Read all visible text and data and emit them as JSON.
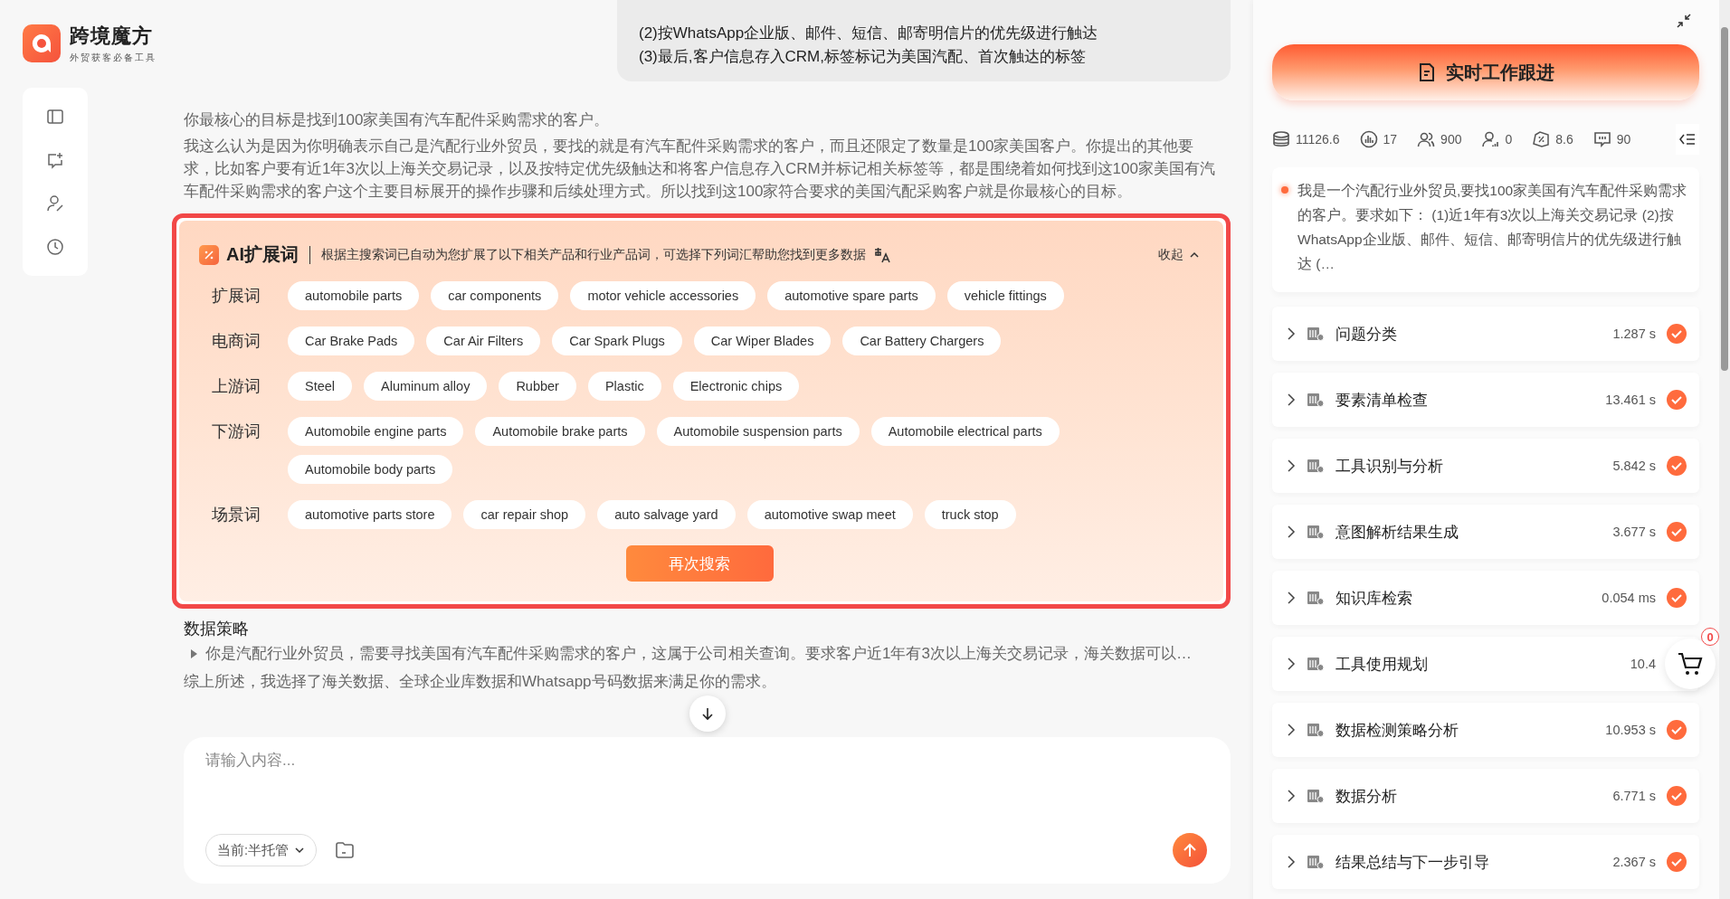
{
  "brand": {
    "name": "跨境魔方",
    "tagline": "外贸获客必备工具"
  },
  "chat": {
    "user_bubble": [
      "(2)按WhatsApp企业版、邮件、短信、邮寄明信片的优先级进行触达",
      "(3)最后,客户信息存入CRM,标签标记为美国汽配、首次触达的标签"
    ],
    "paragraphs": [
      "你最核心的目标是找到100家美国有汽车配件采购需求的客户。",
      "我这么认为是因为你明确表示自己是汽配行业外贸员，要找的就是有汽车配件采购需求的客户，而且还限定了数量是100家美国客户。你提出的其他要求，比如客户要有近1年3次以上海关交易记录，以及按特定优先级触达和将客户信息存入CRM并标记相关标签等，都是围绕着如何找到这100家美国有汽车配件采购需求的客户这个主要目标展开的操作步骤和后续处理方式。所以找到这100家符合要求的美国汽配采购客户就是你最核心的目标。"
    ]
  },
  "ai_panel": {
    "title": "AI扩展词",
    "description": "根据主搜索词已自动为您扩展了以下相关产品和行业产品词，可选择下列词汇帮助您找到更多数据",
    "collapse": "收起",
    "expanded": true,
    "groups": [
      {
        "label": "扩展词",
        "terms": [
          "automobile parts",
          "car components",
          "motor vehicle accessories",
          "automotive spare parts",
          "vehicle fittings"
        ]
      },
      {
        "label": "电商词",
        "terms": [
          "Car Brake Pads",
          "Car Air Filters",
          "Car Spark Plugs",
          "Car Wiper Blades",
          "Car Battery Chargers"
        ]
      },
      {
        "label": "上游词",
        "terms": [
          "Steel",
          "Aluminum alloy",
          "Rubber",
          "Plastic",
          "Electronic chips"
        ]
      },
      {
        "label": "下游词",
        "terms": [
          "Automobile engine parts",
          "Automobile brake parts",
          "Automobile suspension parts",
          "Automobile electrical parts",
          "Automobile body parts"
        ]
      },
      {
        "label": "场景词",
        "terms": [
          "automotive parts store",
          "car repair shop",
          "auto salvage yard",
          "automotive swap meet",
          "truck stop"
        ]
      }
    ],
    "search_button": "再次搜索"
  },
  "strategy": {
    "title": "数据策略",
    "summary": "你是汽配行业外贸员，需要寻找美国有汽车配件采购需求的客户，这属于公司相关查询。要求客户近1年有3次以上海关交易记录，海关数据可以…",
    "expanded": false,
    "conclusion": "综上所述，我选择了海关数据、全球企业库数据和Whatsapp号码数据来满足你的需求。"
  },
  "composer": {
    "placeholder": "请输入内容...",
    "mode": "当前:半托管"
  },
  "tracker": {
    "title": "实时工作跟进",
    "stats": [
      {
        "kind": "coins",
        "value": "11126.6"
      },
      {
        "kind": "chart",
        "value": "17"
      },
      {
        "kind": "users",
        "value": "900"
      },
      {
        "kind": "user-signal",
        "value": "0"
      },
      {
        "kind": "discount",
        "value": "8.6"
      },
      {
        "kind": "chat",
        "value": "90"
      }
    ],
    "task": "我是一个汽配行业外贸员,要找100家美国有汽车配件采购需求的客户。要求如下： (1)近1年有3次以上海关交易记录 (2)按WhatsApp企业版、邮件、短信、邮寄明信片的优先级进行触达 (…",
    "steps": [
      {
        "name": "问题分类",
        "time": "1.287 s",
        "done": true
      },
      {
        "name": "要素清单检查",
        "time": "13.461 s",
        "done": true
      },
      {
        "name": "工具识别与分析",
        "time": "5.842 s",
        "done": true
      },
      {
        "name": "意图解析结果生成",
        "time": "3.677 s",
        "done": true
      },
      {
        "name": "知识库检索",
        "time": "0.054 ms",
        "done": true
      },
      {
        "name": "工具使用规划",
        "time": "10.4",
        "done": false
      },
      {
        "name": "数据检测策略分析",
        "time": "10.953 s",
        "done": true
      },
      {
        "name": "数据分析",
        "time": "6.771 s",
        "done": true
      },
      {
        "name": "结果总结与下一步引导",
        "time": "2.367 s",
        "done": true
      }
    ]
  },
  "cart": {
    "count": "0"
  }
}
